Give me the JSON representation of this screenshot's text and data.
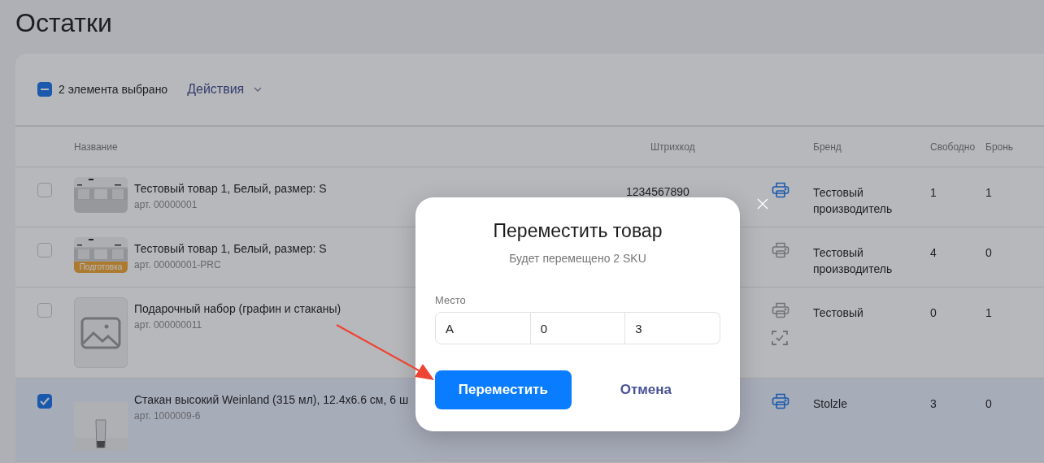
{
  "page": {
    "title": "Остатки"
  },
  "toolbar": {
    "indeterminate": true,
    "selection_text": "2 элемента выбрано",
    "actions_label": "Действия"
  },
  "table": {
    "columns": [
      {
        "label": "Название",
        "kind": "name"
      },
      {
        "label": "Штрихкод",
        "kind": "barcode"
      },
      {
        "label": "Бренд",
        "kind": "brand"
      },
      {
        "label": "Свободно",
        "kind": "free"
      },
      {
        "label": "Бронь",
        "kind": "reserve"
      }
    ],
    "rows": [
      {
        "selected": false,
        "name": "Тестовый товар 1, Белый, размер: S",
        "sku": "арт. 00000001",
        "barcode": "1234567890",
        "print_enabled": true,
        "scan_marked": false,
        "brand": "Тестовый производитель",
        "free": "1",
        "reserve": "1"
      },
      {
        "selected": false,
        "thumbnail": {
          "kind": "picture",
          "badge": "Подготовка"
        },
        "name": "Тестовый товар 1, Белый, размер: S",
        "sku": "арт. 00000001-PRC",
        "print_enabled": false,
        "scan_marked": false,
        "brand": "Тестовый производитель",
        "free": "4",
        "reserve": "0"
      },
      {
        "selected": false,
        "thumbnail": {
          "kind": "placeholder"
        },
        "name": "Подарочный набор (графин и стаканы)",
        "sku": "арт. 000000011",
        "print_enabled": false,
        "scan_marked": true,
        "brand": "Тестовый",
        "free": "0",
        "reserve": "1"
      },
      {
        "selected": true,
        "name": "Стакан высокий Weinland (315 мл), 12.4x6.6 см, 6 ш",
        "sku": "арт. 1000009-6",
        "print_enabled": true,
        "scan_marked": false,
        "brand": "Stolzle",
        "free": "3",
        "reserve": "0"
      }
    ]
  },
  "modal": {
    "title": "Переместить товар",
    "subtitle": "Будет перемещено 2 SKU",
    "field_label": "Место",
    "place_values": [
      "A",
      "0",
      "3"
    ],
    "buttons": [
      {
        "label": "Переместить",
        "kind": "primary"
      },
      {
        "label": "Отмена",
        "kind": "secondary"
      }
    ]
  }
}
